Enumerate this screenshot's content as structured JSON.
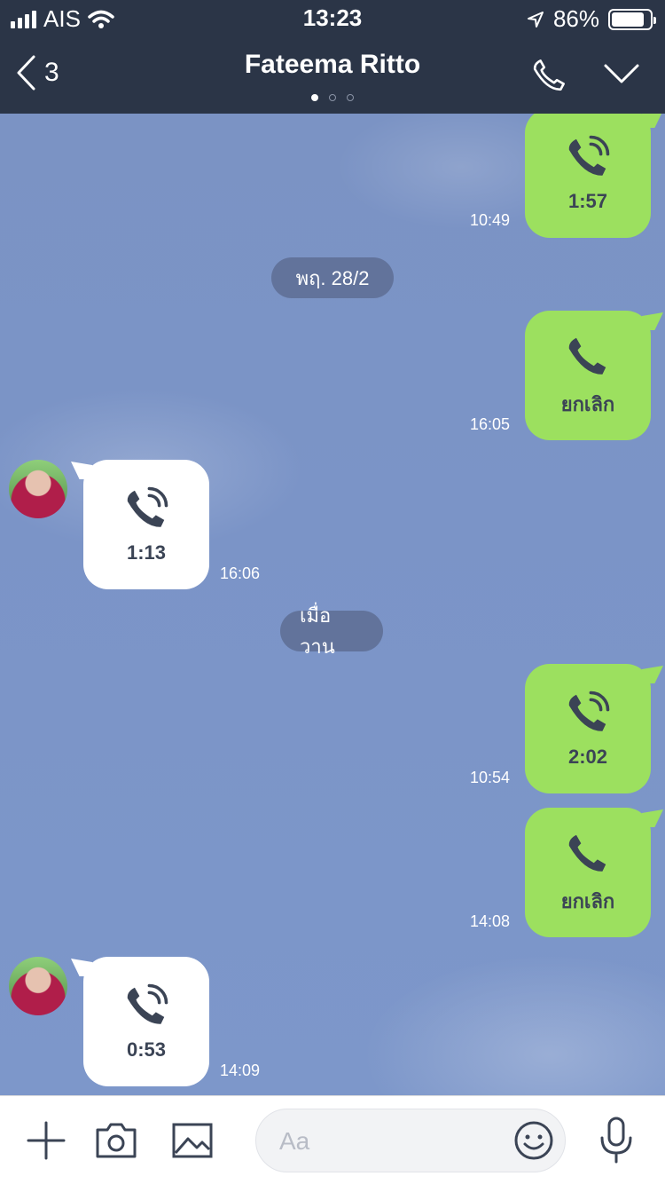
{
  "status_bar": {
    "carrier": "AIS",
    "time": "13:23",
    "battery": "86%",
    "battery_level": 0.86
  },
  "header": {
    "back_count": "3",
    "title": "Fateema Ritto",
    "pages": 3,
    "active_page": 0
  },
  "messages": [
    {
      "id": "m1",
      "side": "out",
      "type": "call-answered",
      "label": "1:57",
      "time": "10:49"
    },
    {
      "id": "d1",
      "type": "date",
      "label": "พฤ. 28/2"
    },
    {
      "id": "m2",
      "side": "out",
      "type": "call-canceled",
      "label": "ยกเลิก",
      "time": "16:05"
    },
    {
      "id": "m3",
      "side": "in",
      "type": "call-answered",
      "label": "1:13",
      "time": "16:06"
    },
    {
      "id": "d2",
      "type": "date",
      "label": "เมื่อวาน"
    },
    {
      "id": "m4",
      "side": "out",
      "type": "call-answered",
      "label": "2:02",
      "time": "10:54"
    },
    {
      "id": "m5",
      "side": "out",
      "type": "call-canceled",
      "label": "ยกเลิก",
      "time": "14:08"
    },
    {
      "id": "m6",
      "side": "in",
      "type": "call-answered",
      "label": "0:53",
      "time": "14:09"
    }
  ],
  "input": {
    "placeholder": "Aa"
  },
  "colors": {
    "header_bg": "#2b3547",
    "outgoing_bubble": "#9ce05f",
    "incoming_bubble": "#ffffff",
    "chat_bg": "#7b94c7"
  },
  "icons": [
    "signal-icon",
    "wifi-icon",
    "location-arrow-icon",
    "battery-icon",
    "back-chevron-icon",
    "phone-icon",
    "chevron-down-icon",
    "plus-icon",
    "camera-icon",
    "image-icon",
    "emoji-icon",
    "microphone-icon"
  ]
}
